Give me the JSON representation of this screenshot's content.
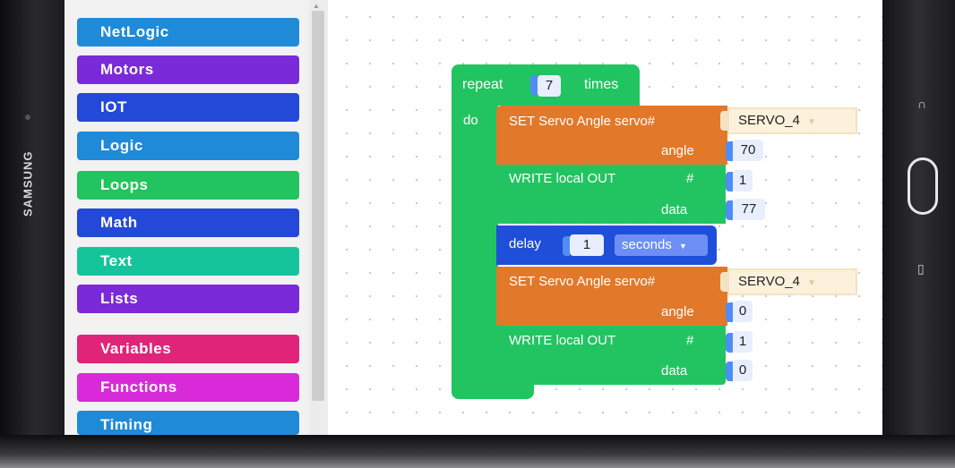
{
  "device": {
    "brand": "SAMSUNG"
  },
  "toolbox": {
    "categories": [
      {
        "label": "NetLogic",
        "color": "#1f8ad8"
      },
      {
        "label": "Motors",
        "color": "#7b2ad9"
      },
      {
        "label": "IOT",
        "color": "#2448d8"
      },
      {
        "label": "Logic",
        "color": "#1f8ad8"
      },
      {
        "label": "Loops",
        "color": "#21c45e"
      },
      {
        "label": "Math",
        "color": "#2448d8"
      },
      {
        "label": "Text",
        "color": "#15c49a"
      },
      {
        "label": "Lists",
        "color": "#7b2ad9"
      },
      {
        "label": "Variables",
        "color": "#e0247a"
      },
      {
        "label": "Functions",
        "color": "#d92ad9"
      },
      {
        "label": "Timing",
        "color": "#1f8ad8"
      }
    ]
  },
  "blocks": {
    "repeat": {
      "label": "repeat",
      "count": "7",
      "times_label": "times",
      "do_label": "do"
    },
    "servo1": {
      "label": "SET Servo Angle servo#",
      "servo": "SERVO_4",
      "angle_label": "angle",
      "angle": "70"
    },
    "write1": {
      "label": "WRITE local OUT",
      "hash_label": "#",
      "pin": "1",
      "data_label": "data",
      "data": "77"
    },
    "delay": {
      "label": "delay",
      "value": "1",
      "unit": "seconds"
    },
    "servo2": {
      "label": "SET Servo Angle servo#",
      "servo": "SERVO_4",
      "angle_label": "angle",
      "angle": "0"
    },
    "write2": {
      "label": "WRITE local OUT",
      "hash_label": "#",
      "pin": "1",
      "data_label": "data",
      "data": "0"
    }
  }
}
